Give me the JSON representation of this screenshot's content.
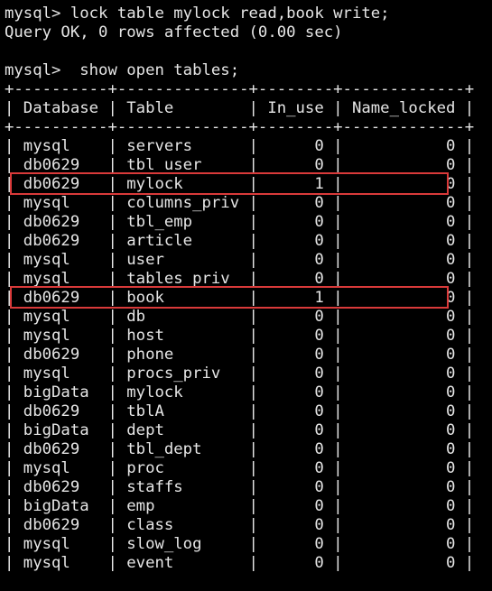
{
  "terminal": {
    "commands": [
      "mysql> lock table mylock read,book write;",
      "Query OK, 0 rows affected (0.00 sec)",
      "",
      "mysql>  show open tables;"
    ],
    "table": {
      "headers": [
        "Database",
        "Table",
        "In_use",
        "Name_locked"
      ],
      "rows": [
        [
          "mysql",
          "servers",
          "0",
          "0"
        ],
        [
          "db0629",
          "tbl_user",
          "0",
          "0"
        ],
        [
          "db0629",
          "mylock",
          "1",
          "0"
        ],
        [
          "mysql",
          "columns_priv",
          "0",
          "0"
        ],
        [
          "db0629",
          "tbl_emp",
          "0",
          "0"
        ],
        [
          "db0629",
          "article",
          "0",
          "0"
        ],
        [
          "mysql",
          "user",
          "0",
          "0"
        ],
        [
          "mysql",
          "tables_priv",
          "0",
          "0"
        ],
        [
          "db0629",
          "book",
          "1",
          "0"
        ],
        [
          "mysql",
          "db",
          "0",
          "0"
        ],
        [
          "mysql",
          "host",
          "0",
          "0"
        ],
        [
          "db0629",
          "phone",
          "0",
          "0"
        ],
        [
          "mysql",
          "procs_priv",
          "0",
          "0"
        ],
        [
          "bigData",
          "mylock",
          "0",
          "0"
        ],
        [
          "db0629",
          "tblA",
          "0",
          "0"
        ],
        [
          "bigData",
          "dept",
          "0",
          "0"
        ],
        [
          "db0629",
          "tbl_dept",
          "0",
          "0"
        ],
        [
          "mysql",
          "proc",
          "0",
          "0"
        ],
        [
          "db0629",
          "staffs",
          "0",
          "0"
        ],
        [
          "bigData",
          "emp",
          "0",
          "0"
        ],
        [
          "db0629",
          "class",
          "0",
          "0"
        ],
        [
          "mysql",
          "slow_log",
          "0",
          "0"
        ],
        [
          "mysql",
          "event",
          "0",
          "0"
        ]
      ],
      "highlighted_rows": [
        2,
        8
      ],
      "highlight_color": "#d93a3a"
    }
  }
}
